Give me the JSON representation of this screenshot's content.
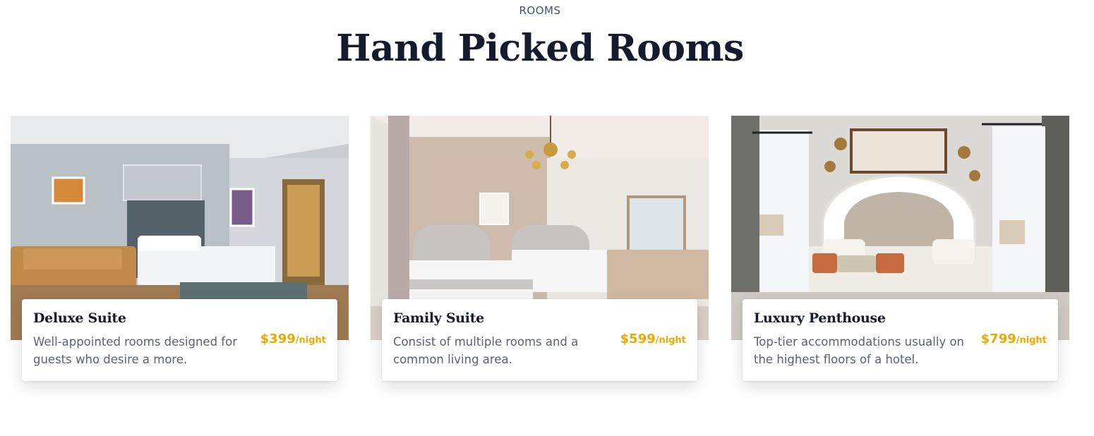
{
  "section": {
    "eyebrow": "ROOMS",
    "title": "Hand Picked Rooms"
  },
  "rooms": [
    {
      "name": "Deluxe Suite",
      "description": "Well-appointed rooms designed for guests who desire a more.",
      "price": "$399",
      "unit": "/night",
      "image": "deluxe-suite-photo"
    },
    {
      "name": "Family Suite",
      "description": "Consist of multiple rooms and a common living area.",
      "price": "$599",
      "unit": "/night",
      "image": "family-suite-photo"
    },
    {
      "name": "Luxury Penthouse",
      "description": "Top-tier accommodations usually on the highest floors of a hotel.",
      "price": "$799",
      "unit": "/night",
      "image": "luxury-penthouse-photo"
    }
  ],
  "colors": {
    "accent": "#f0a800",
    "heading": "#141b2d",
    "body_text": "#5b6275"
  }
}
